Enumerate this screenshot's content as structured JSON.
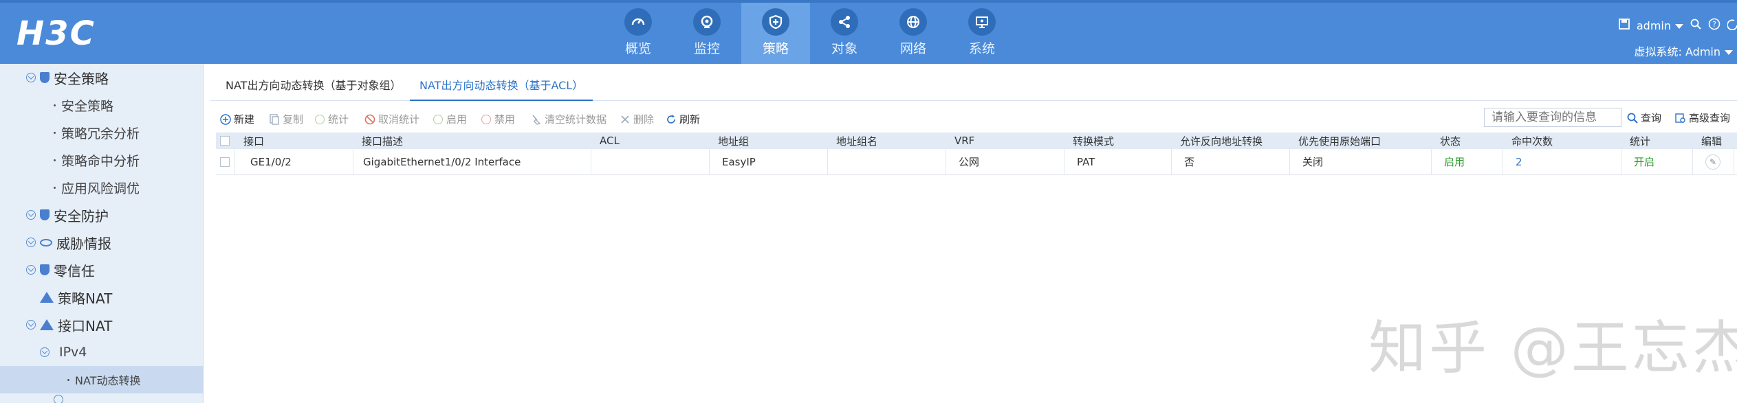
{
  "header": {
    "logo": "H3C",
    "nav": [
      {
        "label": "概览",
        "icon": "gauge-icon"
      },
      {
        "label": "监控",
        "icon": "camera-icon"
      },
      {
        "label": "策略",
        "icon": "shield-plus-icon",
        "active": true
      },
      {
        "label": "对象",
        "icon": "share-icon"
      },
      {
        "label": "网络",
        "icon": "globe-icon"
      },
      {
        "label": "系统",
        "icon": "monitor-icon"
      }
    ],
    "user": "admin",
    "vsys_label": "虚拟系统: Admin"
  },
  "sidebar": {
    "items": [
      {
        "label": "安全策略",
        "level": 0
      },
      {
        "label": "安全策略",
        "level": 1
      },
      {
        "label": "策略冗余分析",
        "level": 1
      },
      {
        "label": "策略命中分析",
        "level": 1
      },
      {
        "label": "应用风险调优",
        "level": 1
      },
      {
        "label": "安全防护",
        "level": 0
      },
      {
        "label": "威胁情报",
        "level": 0
      },
      {
        "label": "零信任",
        "level": 0
      },
      {
        "label": "策略NAT",
        "level": 0
      },
      {
        "label": "接口NAT",
        "level": 0
      },
      {
        "label": "IPv4",
        "level": 1
      },
      {
        "label": "NAT动态转换",
        "level": 2,
        "active": true
      }
    ]
  },
  "tabs": [
    {
      "label": "NAT出方向动态转换（基于对象组）"
    },
    {
      "label": "NAT出方向动态转换（基于ACL）",
      "active": true
    }
  ],
  "toolbar": {
    "new": "新建",
    "copy": "复制",
    "stats": "统计",
    "cancel_stats": "取消统计",
    "enable": "启用",
    "disable": "禁用",
    "clear_stats": "清空统计数据",
    "delete": "删除",
    "refresh": "刷新",
    "search_placeholder": "请输入要查询的信息",
    "search": "查询",
    "advanced_search": "高级查询"
  },
  "table": {
    "columns": [
      "接口",
      "接口描述",
      "ACL",
      "地址组",
      "地址组名",
      "VRF",
      "转换模式",
      "允许反向地址转换",
      "优先使用原始端口",
      "状态",
      "命中次数",
      "统计",
      "编辑"
    ],
    "rows": [
      {
        "interface": "GE1/0/2",
        "description": "GigabitEthernet1/0/2 Interface",
        "acl": "",
        "address_group": "EasyIP",
        "address_group_name": "",
        "vrf": "公网",
        "mode": "PAT",
        "reverse": "否",
        "original_port": "关闭",
        "status": "启用",
        "hits": "2",
        "stats": "开启"
      }
    ]
  },
  "watermark": "知乎 @王忘杰",
  "colors": {
    "header": "#4a8ad9",
    "accent": "#2c74c9",
    "enabled": "#2a9a2a"
  }
}
